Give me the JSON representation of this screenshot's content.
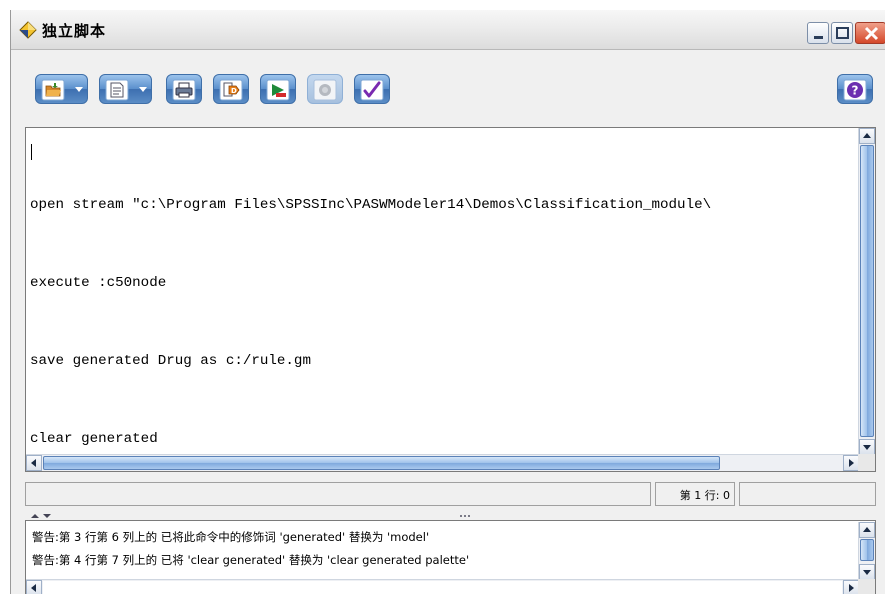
{
  "window": {
    "title": "独立脚本"
  },
  "toolbar": {
    "buttons": [
      {
        "name": "open-file-button",
        "icon": "folder-open-icon",
        "dropdown": true
      },
      {
        "name": "save-file-button",
        "icon": "document-save-icon",
        "dropdown": true
      },
      {
        "name": "print-button",
        "icon": "printer-icon",
        "dropdown": false
      },
      {
        "name": "import-script-button",
        "icon": "import-icon",
        "dropdown": false
      },
      {
        "name": "run-script-button",
        "icon": "run-icon",
        "dropdown": false
      },
      {
        "name": "stop-button",
        "icon": "stop-icon",
        "dropdown": false,
        "disabled": true
      },
      {
        "name": "check-syntax-button",
        "icon": "checkmark-icon",
        "dropdown": false
      }
    ],
    "help_icon": "help-icon"
  },
  "editor": {
    "lines": [
      "open stream \"c:\\Program Files\\SPSSInc\\PASWModeler14\\Demos\\Classification_module\\",
      "execute :c50node",
      "save generated Drug as c:/rule.gm",
      "clear generated"
    ]
  },
  "status": {
    "position": "第 1 行: 0"
  },
  "messages": [
    "警告:第 3 行第 6 列上的 已将此命令中的修饰词 'generated' 替换为 'model'",
    "警告:第 4 行第 7 列上的 已将 'clear generated' 替换为 'clear generated palette'"
  ],
  "colors": {
    "button_blue": "#5a8fcc",
    "title_icon_yellow": "#f4c430",
    "close_red": "#d4482a"
  }
}
